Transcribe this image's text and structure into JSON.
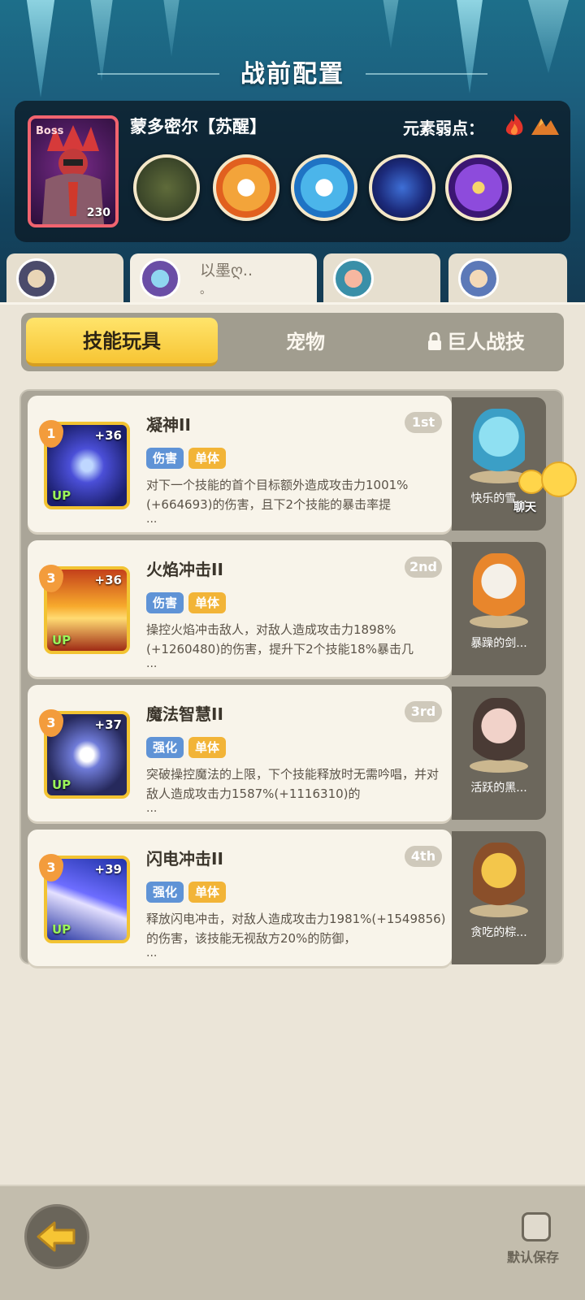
{
  "header": {
    "title": "战前配置"
  },
  "boss": {
    "badge": "Boss",
    "level": "230",
    "name": "蒙多密尔【苏醒】",
    "weakness_label": "元素弱点：",
    "weakness_icons": [
      "fire-icon",
      "earth-icon"
    ],
    "skills": [
      "skill-orb-1",
      "skill-orb-2",
      "skill-orb-3",
      "skill-orb-4",
      "skill-orb-5"
    ]
  },
  "team": {
    "active_member_name": "以墨ღ..",
    "active_member_sub": "。"
  },
  "tabs": {
    "skill": "技能玩具",
    "pet": "宠物",
    "giant": "巨人战技"
  },
  "skills": [
    {
      "order": "1st",
      "level": "1",
      "plus": "+36",
      "up": "UP",
      "name": "凝神II",
      "type": "伤害",
      "target": "单体",
      "desc": "对下一个技能的首个目标额外造成攻击力1001%(+664693)的伤害，且下2个技能的暴击率提",
      "more": "...",
      "pet_name": "快乐的雪..."
    },
    {
      "order": "2nd",
      "level": "3",
      "plus": "+36",
      "up": "UP",
      "name": "火焰冲击II",
      "type": "伤害",
      "target": "单体",
      "desc": "操控火焰冲击敌人，对敌人造成攻击力1898%(+1260480)的伤害，提升下2个技能18%暴击几",
      "more": "...",
      "pet_name": "暴躁的剑..."
    },
    {
      "order": "3rd",
      "level": "3",
      "plus": "+37",
      "up": "UP",
      "name": "魔法智慧II",
      "type": "强化",
      "target": "单体",
      "desc": "突破操控魔法的上限，下个技能释放时无需吟唱，并对敌人造成攻击力1587%(+1116310)的",
      "more": "...",
      "pet_name": "活跃的黑..."
    },
    {
      "order": "4th",
      "level": "3",
      "plus": "+39",
      "up": "UP",
      "name": "闪电冲击II",
      "type": "强化",
      "target": "单体",
      "desc": "释放闪电冲击，对敌人造成攻击力1981%(+1549856)的伤害，该技能无视敌方20%的防御，",
      "more": "...",
      "pet_name": "贪吃的棕..."
    }
  ],
  "chat": {
    "label": "聊天"
  },
  "bottom": {
    "save_label": "默认保存"
  }
}
